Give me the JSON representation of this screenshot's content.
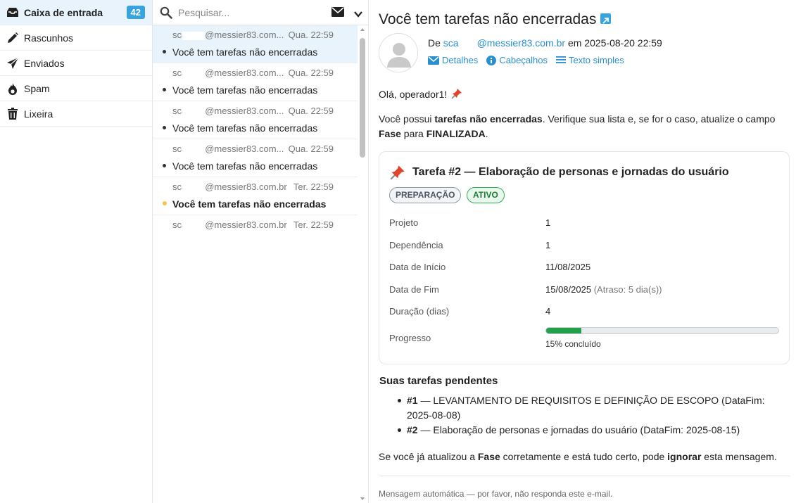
{
  "sidebar": {
    "items": [
      {
        "label": "Caixa de entrada",
        "icon": "inbox-icon",
        "badge": "42",
        "active": true
      },
      {
        "label": "Rascunhos",
        "icon": "pencil-icon"
      },
      {
        "label": "Enviados",
        "icon": "paper-plane-icon"
      },
      {
        "label": "Spam",
        "icon": "fire-icon"
      },
      {
        "label": "Lixeira",
        "icon": "trash-icon"
      }
    ]
  },
  "list": {
    "search_placeholder": "Pesquisar...",
    "messages": [
      {
        "from": "sca",
        "from_domain": "@messier83.com...",
        "date": "Qua. 22:59",
        "subject": "Você tem tarefas não encerradas"
      },
      {
        "from": "sca",
        "from_domain": "@messier83.com...",
        "date": "Qua. 22:59",
        "subject": "Você tem tarefas não encerradas"
      },
      {
        "from": "sca",
        "from_domain": "@messier83.com...",
        "date": "Qua. 22:59",
        "subject": "Você tem tarefas não encerradas"
      },
      {
        "from": "sca",
        "from_domain": "@messier83.com...",
        "date": "Qua. 22:59",
        "subject": "Você tem tarefas não encerradas"
      },
      {
        "from": "sca",
        "from_domain": "@messier83.com.br",
        "date": "Ter. 22:59",
        "subject": "Você tem tarefas não encerradas"
      },
      {
        "from": "sca",
        "from_domain": "@messier83.com.br",
        "date": "Ter. 22:59",
        "subject": ""
      }
    ]
  },
  "message": {
    "title": "Você tem tarefas não encerradas",
    "from_prefix": "De",
    "from_local": "sca",
    "from_domain": "@messier83.com.br",
    "date_text": "em 2025-08-20 22:59",
    "links": {
      "details": "Detalhes",
      "headers": "Cabeçalhos",
      "plain": "Texto simples"
    },
    "greeting": "Olá, operador1!",
    "intro_1": "Você possui ",
    "intro_bold_1": "tarefas não encerradas",
    "intro_2": ". Verifique sua lista e, se for o caso, atualize o campo",
    "intro_bold_2": "Fase",
    "intro_3": " para ",
    "intro_bold_3": "FINALIZADA",
    "intro_4": ".",
    "card": {
      "title": "Tarefa #2 — Elaboração de personas e jornadas do usuário",
      "tag_phase": "PREPARAÇÃO",
      "tag_status": "ATIVO",
      "rows": [
        {
          "key": "Projeto",
          "value": "1"
        },
        {
          "key": "Dependência",
          "value": "1"
        },
        {
          "key": "Data de Início",
          "value": "11/08/2025"
        },
        {
          "key": "Data de Fim",
          "value": "15/08/2025",
          "note": "(Atraso: 5 dia(s))"
        },
        {
          "key": "Duração (dias)",
          "value": "4"
        }
      ],
      "progress_label_key": "Progresso",
      "progress": 0.15,
      "progress_text": "15% concluído"
    },
    "pending_title": "Suas tarefas pendentes",
    "pending": [
      {
        "id": "#1",
        "text": " — LEVANTAMENTO DE REQUISITOS E DEFINIÇÃO DE ESCOPO (DataFim: 2025-08-08)"
      },
      {
        "id": "#2",
        "text": " — Elaboração de personas e jornadas do usuário (DataFim: 2025-08-15)"
      }
    ],
    "closing_1": "Se você já atualizou a ",
    "closing_bold_1": "Fase",
    "closing_2": " corretamente e está tudo certo, pode ",
    "closing_bold_2": "ignorar",
    "closing_3": " esta mensagem.",
    "footer": "Mensagem automática — por favor, não responda este e-mail."
  },
  "colors": {
    "accent": "#37a4e0",
    "link": "#2a8fd0",
    "selected_bg": "#e8f3fb",
    "progress": "#22a04b"
  }
}
